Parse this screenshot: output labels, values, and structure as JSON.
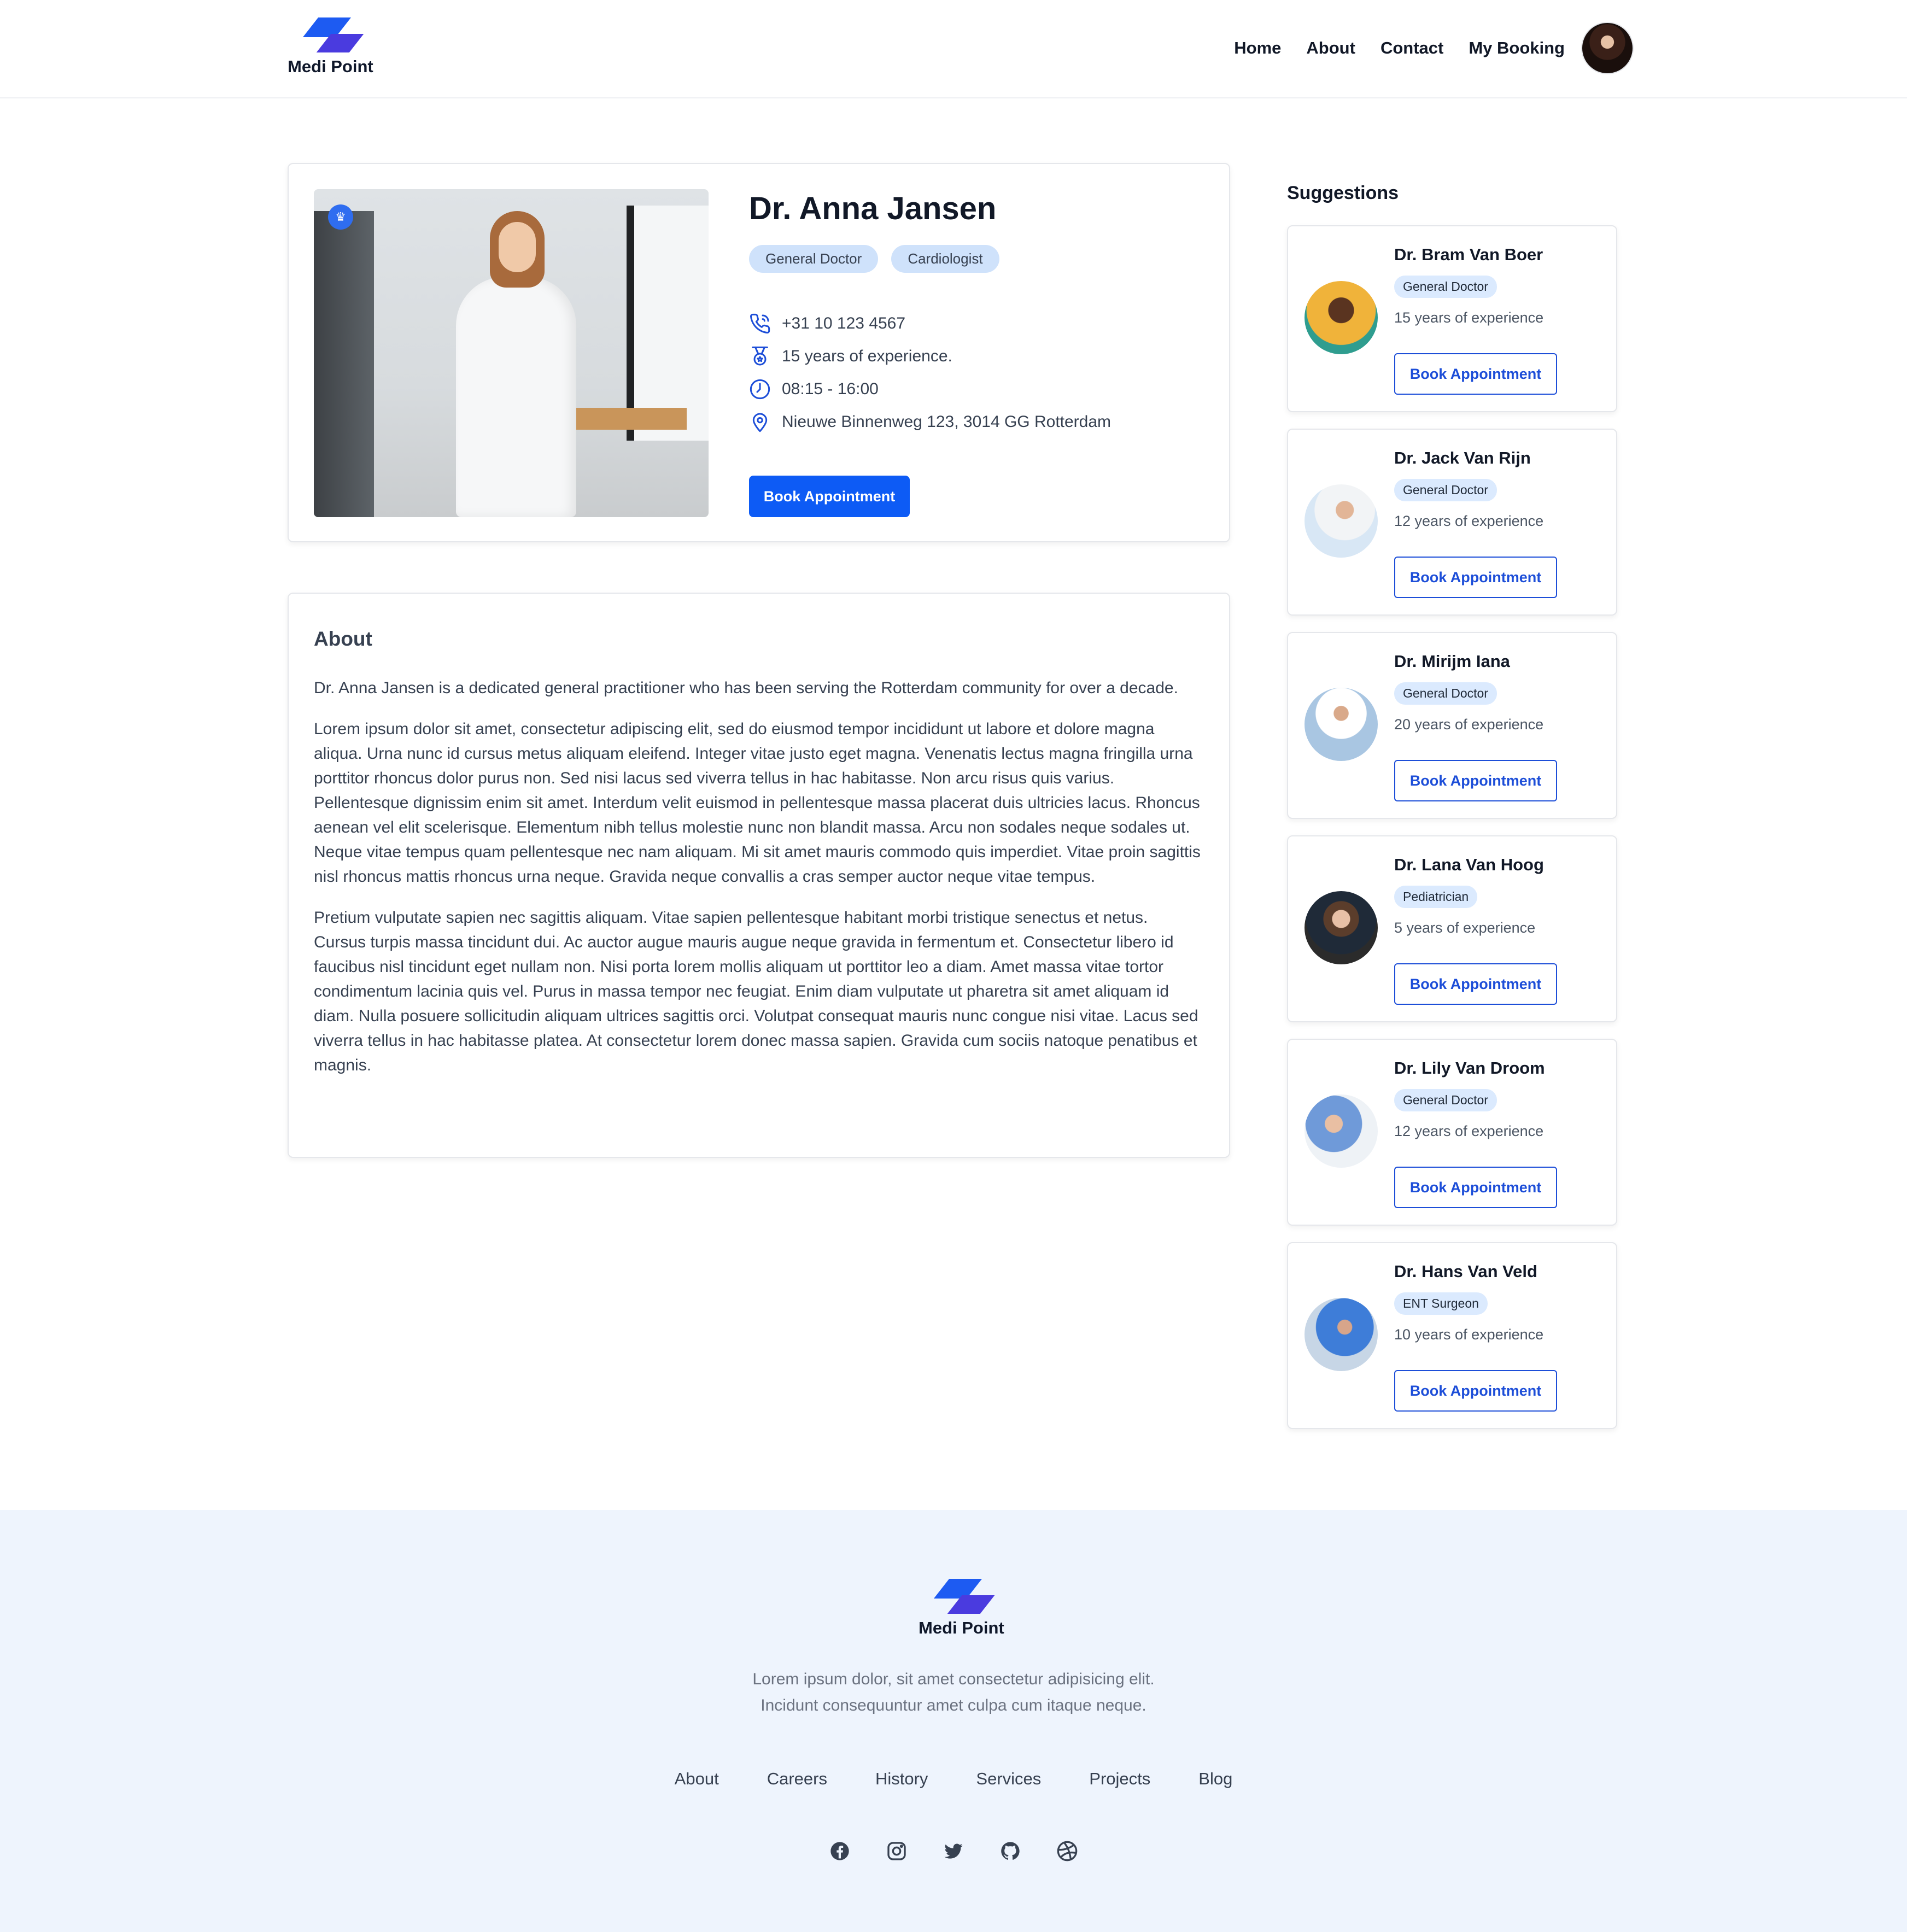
{
  "brand": {
    "name": "Medi Point"
  },
  "nav": {
    "home": "Home",
    "about": "About",
    "contact": "Contact",
    "booking": "My Booking"
  },
  "doctor": {
    "name": "Dr. Anna Jansen",
    "tags": [
      "General Doctor",
      "Cardiologist"
    ],
    "phone": "+31 10 123 4567",
    "experience": "15 years of experience.",
    "hours": "08:15 - 16:00",
    "address": "Nieuwe Binnenweg 123, 3014 GG Rotterdam",
    "book_label": "Book Appointment"
  },
  "about": {
    "title": "About",
    "paragraphs": [
      "Dr. Anna Jansen is a dedicated general practitioner who has been serving the Rotterdam community for over a decade.",
      "Lorem ipsum dolor sit amet, consectetur adipiscing elit, sed do eiusmod tempor incididunt ut labore et dolore magna aliqua. Urna nunc id cursus metus aliquam eleifend. Integer vitae justo eget magna. Venenatis lectus magna fringilla urna porttitor rhoncus dolor purus non. Sed nisi lacus sed viverra tellus in hac habitasse. Non arcu risus quis varius. Pellentesque dignissim enim sit amet. Interdum velit euismod in pellentesque massa placerat duis ultricies lacus. Rhoncus aenean vel elit scelerisque. Elementum nibh tellus molestie nunc non blandit massa. Arcu non sodales neque sodales ut. Neque vitae tempus quam pellentesque nec nam aliquam. Mi sit amet mauris commodo quis imperdiet. Vitae proin sagittis nisl rhoncus mattis rhoncus urna neque. Gravida neque convallis a cras semper auctor neque vitae tempus.",
      "Pretium vulputate sapien nec sagittis aliquam. Vitae sapien pellentesque habitant morbi tristique senectus et netus. Cursus turpis massa tincidunt dui. Ac auctor augue mauris augue neque gravida in fermentum et. Consectetur libero id faucibus nisl tincidunt eget nullam non. Nisi porta lorem mollis aliquam ut porttitor leo a diam. Amet massa vitae tortor condimentum lacinia quis vel. Purus in massa tempor nec feugiat. Enim diam vulputate ut pharetra sit amet aliquam id diam. Nulla posuere sollicitudin aliquam ultrices sagittis orci. Volutpat consequat mauris nunc congue nisi vitae. Lacus sed viverra tellus in hac habitasse platea. At consectetur lorem donec massa sapien. Gravida cum sociis natoque penatibus et magnis."
    ]
  },
  "suggestions": {
    "title": "Suggestions",
    "items": [
      {
        "name": "Dr. Bram Van Boer",
        "specialty": "General Doctor",
        "experience": "15 years of experience",
        "button": "Book Appointment"
      },
      {
        "name": "Dr. Jack Van Rijn",
        "specialty": "General Doctor",
        "experience": "12 years of experience",
        "button": "Book Appointment"
      },
      {
        "name": "Dr. Mirijm Iana",
        "specialty": "General Doctor",
        "experience": "20 years of experience",
        "button": "Book Appointment"
      },
      {
        "name": "Dr. Lana Van Hoog",
        "specialty": "Pediatrician",
        "experience": "5 years of experience",
        "button": "Book Appointment"
      },
      {
        "name": "Dr. Lily Van Droom",
        "specialty": "General Doctor",
        "experience": "12 years of experience",
        "button": "Book Appointment"
      },
      {
        "name": "Dr. Hans Van Veld",
        "specialty": "ENT Surgeon",
        "experience": "10 years of experience",
        "button": "Book Appointment"
      }
    ]
  },
  "footer": {
    "tagline_line1": "Lorem ipsum dolor, sit amet consectetur adipisicing elit.",
    "tagline_line2": "Incidunt consequuntur amet culpa cum itaque neque.",
    "links": [
      "About",
      "Careers",
      "History",
      "Services",
      "Projects",
      "Blog"
    ],
    "socials": [
      "facebook-icon",
      "instagram-icon",
      "twitter-icon",
      "github-icon",
      "dribbble-icon"
    ]
  },
  "colors": {
    "primary": "#0d5bf5",
    "tag_bg": "#cfe2fb",
    "footer_bg": "#eef4fd"
  }
}
